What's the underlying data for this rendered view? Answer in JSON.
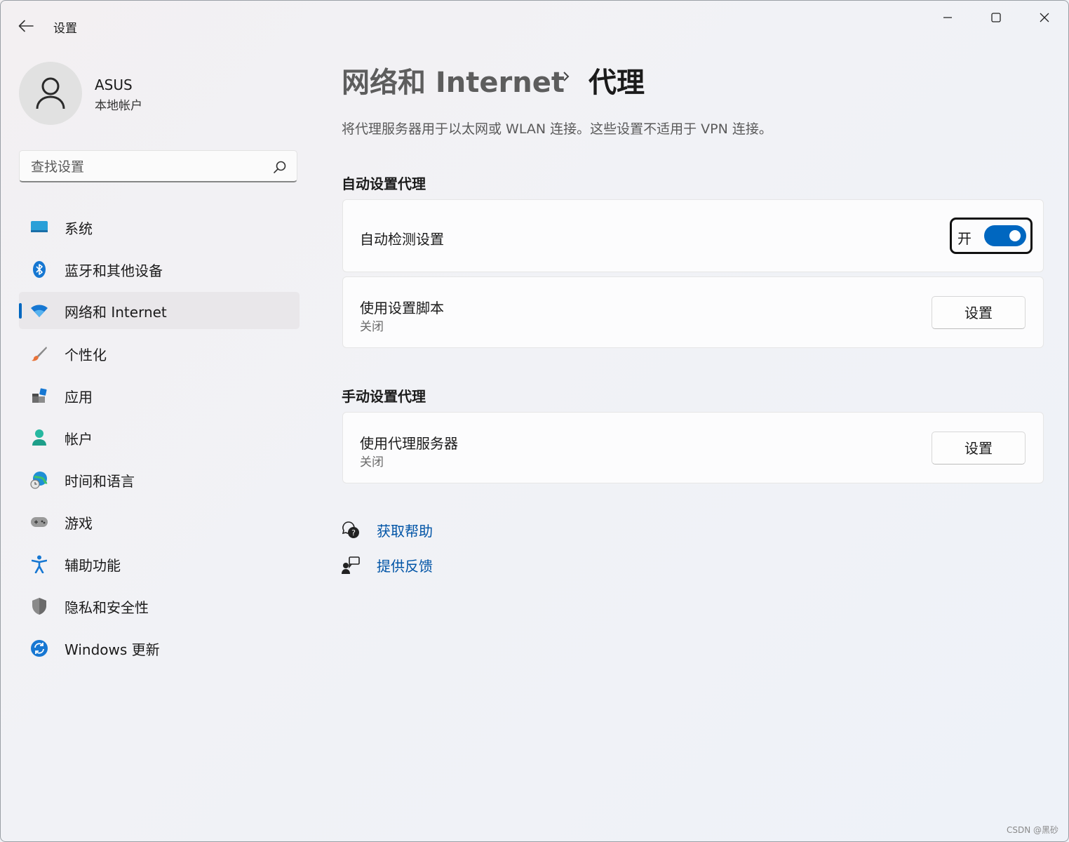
{
  "window": {
    "app_title": "设置"
  },
  "profile": {
    "name": "ASUS",
    "subtitle": "本地帐户"
  },
  "search": {
    "placeholder": "查找设置",
    "value": ""
  },
  "nav": {
    "items": [
      {
        "label": "系统",
        "icon": "system-icon"
      },
      {
        "label": "蓝牙和其他设备",
        "icon": "bluetooth-icon"
      },
      {
        "label": "网络和 Internet",
        "icon": "wifi-icon",
        "selected": true
      },
      {
        "label": "个性化",
        "icon": "brush-icon"
      },
      {
        "label": "应用",
        "icon": "apps-icon"
      },
      {
        "label": "帐户",
        "icon": "person-icon"
      },
      {
        "label": "时间和语言",
        "icon": "globe-clock-icon"
      },
      {
        "label": "游戏",
        "icon": "gamepad-icon"
      },
      {
        "label": "辅助功能",
        "icon": "accessibility-icon"
      },
      {
        "label": "隐私和安全性",
        "icon": "shield-icon"
      },
      {
        "label": "Windows 更新",
        "icon": "update-icon"
      }
    ]
  },
  "main": {
    "breadcrumb_parent": "网络和 Internet",
    "breadcrumb_current": "代理",
    "description": "将代理服务器用于以太网或 WLAN 连接。这些设置不适用于 VPN 连接。",
    "auto_section_title": "自动设置代理",
    "auto_detect": {
      "label": "自动检测设置",
      "toggle_text": "开",
      "on": true
    },
    "setup_script": {
      "label": "使用设置脚本",
      "status": "关闭",
      "button": "设置"
    },
    "manual_section_title": "手动设置代理",
    "proxy_server": {
      "label": "使用代理服务器",
      "status": "关闭",
      "button": "设置"
    },
    "links": {
      "get_help": "获取帮助",
      "feedback": "提供反馈"
    }
  },
  "colors": {
    "accent": "#0067c0",
    "link": "#0054a6",
    "selected_bg": "#e9e7ea"
  },
  "watermark": "CSDN @黑砂"
}
